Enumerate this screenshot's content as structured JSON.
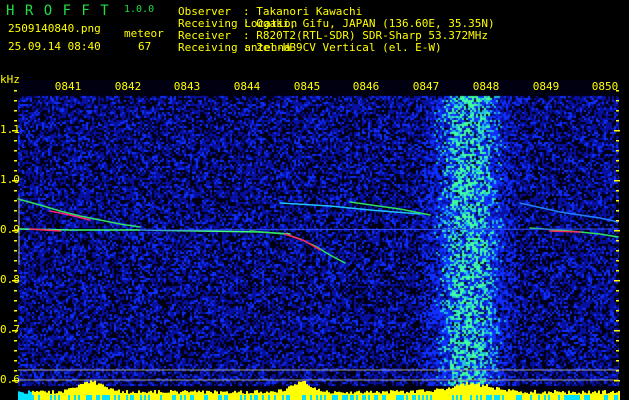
{
  "app": {
    "name": "H R O F F T",
    "version": "1.0.0"
  },
  "file": {
    "name": "2509140840.png",
    "datetime": "25.09.14 08:40"
  },
  "meteor": {
    "label": "meteor",
    "count": "67"
  },
  "info": [
    {
      "key": "Observer",
      "value": ": Takanori Kawachi"
    },
    {
      "key": "Receiving Location",
      "value": ": Ogaki, Gifu, JAPAN (136.60E, 35.35N)"
    },
    {
      "key": "Receiver",
      "value": ": R820T2(RTL-SDR) SDR-Sharp 53.372MHz"
    },
    {
      "key": "Receiving antenna",
      "value": ": 2el-HB9CV Vertical (el. E-W)"
    }
  ],
  "axis": {
    "unit": "kHz",
    "y_ticks": [
      "1.1",
      "1.0",
      "0.9",
      "0.8",
      "0.7",
      "0.6"
    ],
    "x_ticks": [
      "0841",
      "0842",
      "0843",
      "0844",
      "0845",
      "0846",
      "0847",
      "0848",
      "0849",
      "0850"
    ]
  },
  "colors": {
    "text": "#ffff00",
    "title": "#22dd44",
    "noise": "#0a14c8",
    "histogram": "#ffff00",
    "histogram_low": "#00e0ff"
  }
}
